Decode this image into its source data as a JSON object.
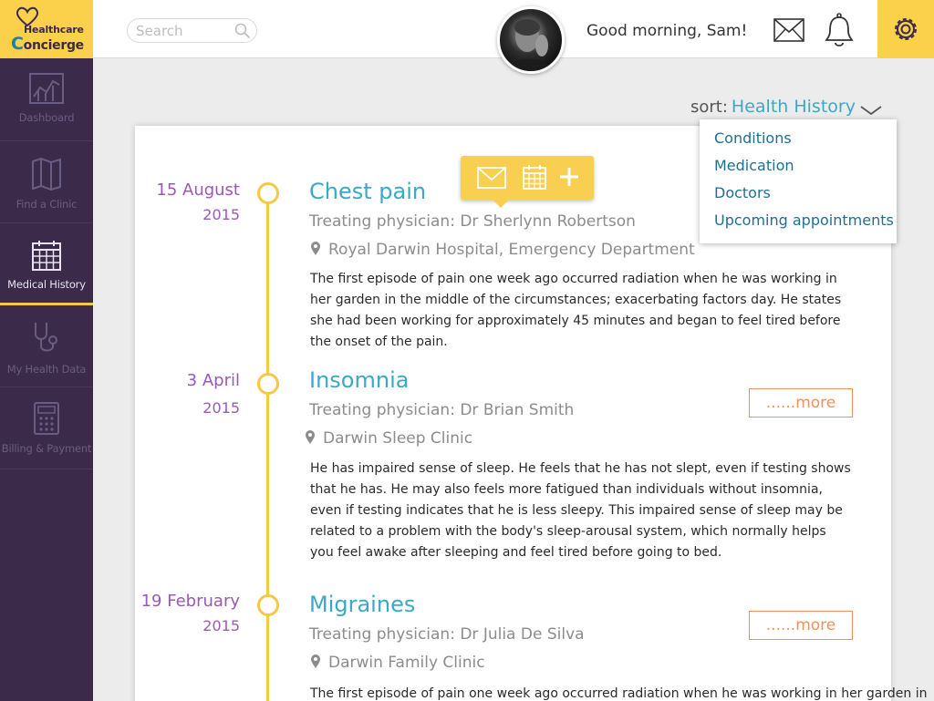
{
  "brand": {
    "line1": "Healthcare",
    "line2_c": "C",
    "line2_rest": "oncierge"
  },
  "sidebar": {
    "items": [
      {
        "label": "Dashboard",
        "icon": "chart-icon"
      },
      {
        "label": "Find a Clinic",
        "icon": "map-icon"
      },
      {
        "label": "Medical History",
        "icon": "calendar-icon",
        "active": true
      },
      {
        "label": "My Health Data",
        "icon": "stethoscope-icon"
      },
      {
        "label": "Billing & Payment",
        "icon": "calculator-icon"
      }
    ]
  },
  "header": {
    "search_placeholder": "Search",
    "greeting": "Good morning, Sam!"
  },
  "sort": {
    "label": "sort:",
    "value": "Health History"
  },
  "dropdown": {
    "options": [
      "Conditions",
      "Medication",
      "Doctors",
      "Upcoming appointments"
    ]
  },
  "entries": [
    {
      "day": "15 August",
      "year": "2015",
      "title": "Chest pain",
      "physician": "Treating physician: Dr Sherlynn Robertson",
      "location": "Royal Darwin Hospital, Emergency Department",
      "text": "The first episode of pain one week ago occurred radiation when he was working in her garden in the middle of the circumstances; exacerbating factors day. He states she had been working for approximately 45 minutes and began to feel tired before the onset of the pain."
    },
    {
      "day": "3 April",
      "year": "2015",
      "title": "Insomnia",
      "physician": "Treating physician: Dr Brian Smith",
      "location": "Darwin Sleep Clinic",
      "more": "......more",
      "text": "He has impaired sense of sleep. He feels that he has not slept, even if testing shows that he has. He may also feels more fatigued than individuals without insomnia, even if testing indicates that he is less sleepy. This impaired sense of sleep may be related to a problem with the body's sleep-arousal system, which normally helps you feel awake after sleeping and feel tired before going to bed."
    },
    {
      "day": "19 February",
      "year": "2015",
      "title": "Migraines",
      "physician": "Treating physician: Dr Julia De Silva",
      "location": "Darwin Family Clinic",
      "more": "......more",
      "text": "The first episode of pain one week ago occurred radiation when he was working in her garden in"
    }
  ],
  "colors": {
    "sidebar_bg": "#3b2a4a",
    "accent_yellow": "#fbd14b",
    "title_blue": "#3aa9c7",
    "date_purple": "#9b59b6",
    "more_orange": "#f0935a"
  }
}
